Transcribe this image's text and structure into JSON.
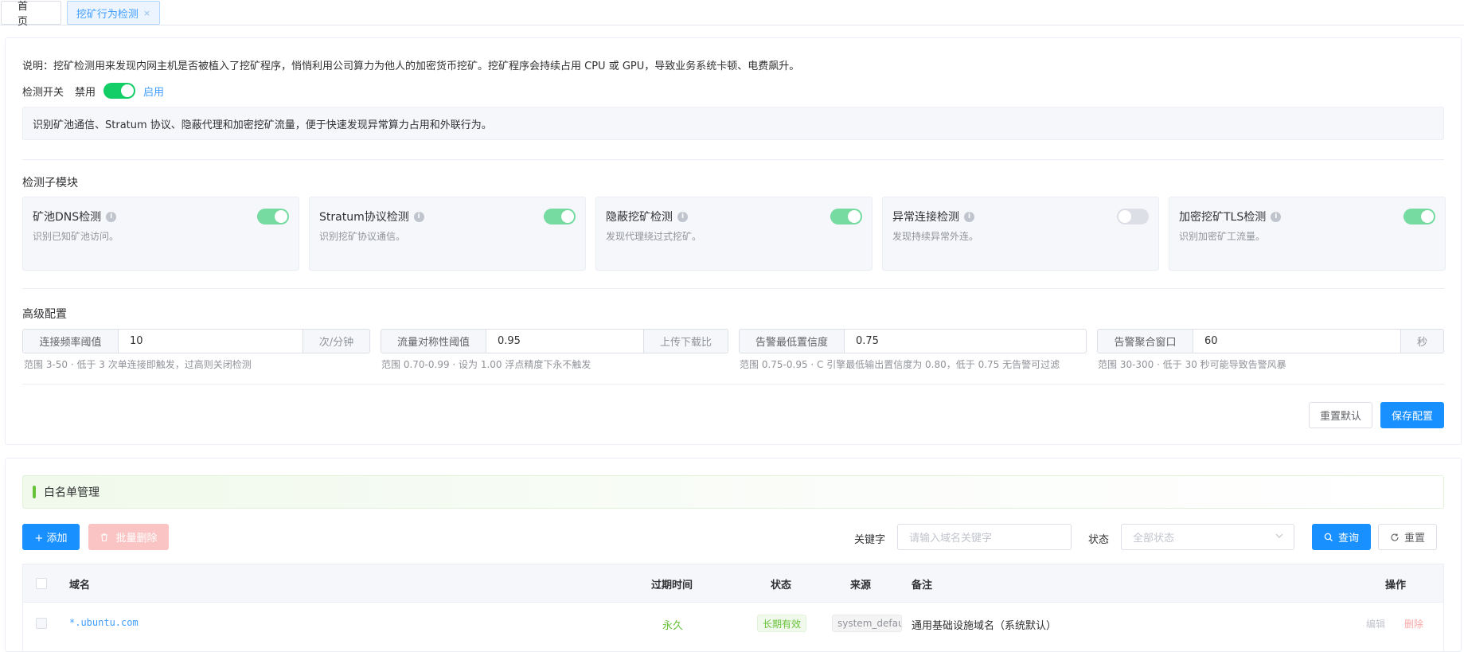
{
  "tabs": {
    "home": "首页",
    "active": "挖矿行为检测",
    "close": "×"
  },
  "description": "说明：挖矿检测用来发现内网主机是否被植入了挖矿程序，悄悄利用公司算力为他人的加密货币挖矿。挖矿程序会持续占用 CPU 或 GPU，导致业务系统卡顿、电费飙升。",
  "detect_switch": {
    "label": "检测开关",
    "off_label": "禁用",
    "on_label": "启用",
    "enabled": true
  },
  "info_text": "识别矿池通信、Stratum 协议、隐蔽代理和加密挖矿流量，便于快速发现异常算力占用和外联行为。",
  "modules_title": "检测子模块",
  "modules": [
    {
      "name": "矿池DNS检测",
      "desc": "识别已知矿池访问。",
      "enabled": true
    },
    {
      "name": "Stratum协议检测",
      "desc": "识别挖矿协议通信。",
      "enabled": true
    },
    {
      "name": "隐蔽挖矿检测",
      "desc": "发现代理绕过式挖矿。",
      "enabled": true
    },
    {
      "name": "异常连接检测",
      "desc": "发现持续异常外连。",
      "enabled": false
    },
    {
      "name": "加密挖矿TLS检测",
      "desc": "识别加密矿工流量。",
      "enabled": true
    }
  ],
  "advanced_title": "高级配置",
  "advanced": [
    {
      "label": "连接频率阈值",
      "value": "10",
      "suffix": "次/分钟",
      "hint": "范围 3-50 · 低于 3 次单连接即触发，过高则关闭检测"
    },
    {
      "label": "流量对称性阈值",
      "value": "0.95",
      "suffix": "上传下载比",
      "hint": "范围 0.70-0.99 · 设为 1.00 浮点精度下永不触发"
    },
    {
      "label": "告警最低置信度",
      "value": "0.75",
      "suffix": "",
      "hint": "范围 0.75-0.95 · C 引擎最低输出置信度为 0.80，低于 0.75 无告警可过滤"
    },
    {
      "label": "告警聚合窗口",
      "value": "60",
      "suffix": "秒",
      "hint": "范围 30-300 · 低于 30 秒可能导致告警风暴"
    }
  ],
  "buttons": {
    "reset_default": "重置默认",
    "save_config": "保存配置"
  },
  "whitelist": {
    "title": "白名单管理",
    "add_label": "+ 添加",
    "batch_delete_label": "批量删除",
    "keyword_label": "关键字",
    "keyword_placeholder": "请输入域名关键字",
    "status_label": "状态",
    "status_placeholder": "全部状态",
    "query_label": "查询",
    "reset_label": "重置",
    "columns": {
      "domain": "域名",
      "expire": "过期时间",
      "status": "状态",
      "source": "来源",
      "remark": "备注",
      "action": "操作"
    },
    "rows": [
      {
        "domain": "*.ubuntu.com",
        "expire": "永久",
        "status": "长期有效",
        "source": "system_default",
        "remark": "通用基础设施域名（系统默认）",
        "edit": "编辑",
        "delete": "删除"
      }
    ]
  },
  "colors": {
    "primary": "#1890ff",
    "switch_on": "#13ce66",
    "success": "#67c23a",
    "danger_disabled": "#fbc4c4"
  }
}
